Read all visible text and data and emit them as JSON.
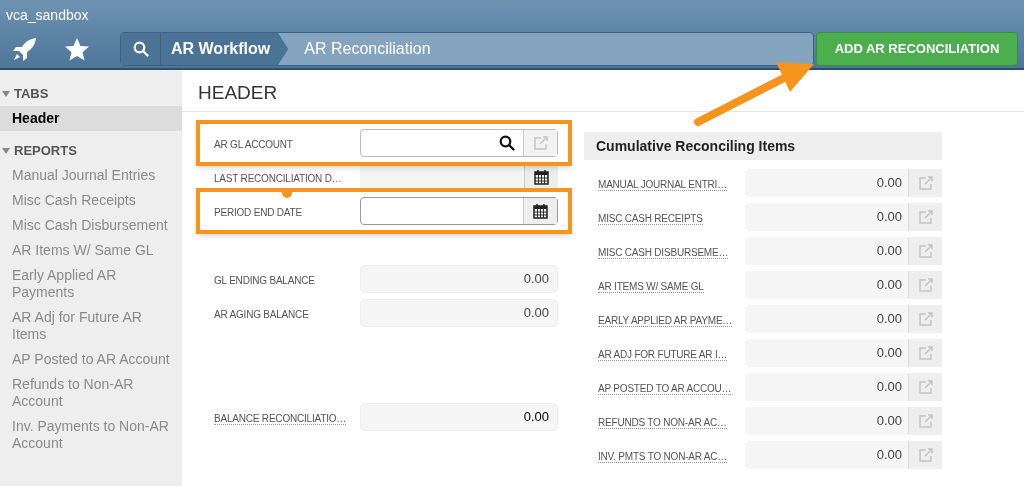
{
  "window": {
    "title": "vca_sandbox"
  },
  "breadcrumbs": [
    {
      "label": "AR Workflow",
      "selected": false
    },
    {
      "label": "AR Reconciliation",
      "selected": true
    }
  ],
  "primary_button": "ADD AR RECONCILIATION",
  "sidebar": {
    "sections": [
      {
        "title": "TABS",
        "expanded": true,
        "items": [
          {
            "label": "Header",
            "selected": true
          }
        ]
      },
      {
        "title": "REPORTS",
        "expanded": true,
        "items": [
          {
            "label": "Manual Journal Entries",
            "selected": false
          },
          {
            "label": "Misc Cash Receipts",
            "selected": false
          },
          {
            "label": "Misc Cash Disbursement",
            "selected": false
          },
          {
            "label": "AR Items W/ Same GL",
            "selected": false
          },
          {
            "label": "Early Applied AR Payments",
            "selected": false
          },
          {
            "label": "AR Adj for Future AR Items",
            "selected": false
          },
          {
            "label": "AP Posted to AR Account",
            "selected": false
          },
          {
            "label": "Refunds to Non-AR Account",
            "selected": false
          },
          {
            "label": "Inv. Payments to Non-AR Account",
            "selected": false
          }
        ]
      }
    ]
  },
  "section_title": "HEADER",
  "fields": [
    {
      "label": "AR GL ACCOUNT",
      "kind": "lookup",
      "highlighted": true
    },
    {
      "label": "LAST RECONCILIATION D…",
      "kind": "date",
      "disabled": true,
      "highlighted": false
    },
    {
      "label": "PERIOD END DATE",
      "kind": "date",
      "disabled": false,
      "highlighted": true
    },
    {
      "label": "GL ENDING BALANCE",
      "kind": "number",
      "value": "0.00",
      "highlighted": false
    },
    {
      "label": "AR AGING BALANCE",
      "kind": "number",
      "value": "0.00",
      "highlighted": false
    },
    {
      "label": "BALANCE RECONCILIATIO…",
      "kind": "total",
      "value": "0.00",
      "highlighted": false
    }
  ],
  "panel": {
    "title": "Cumulative Reconciling Items",
    "rows": [
      {
        "label": "MANUAL JOURNAL ENTRI…",
        "value": "0.00"
      },
      {
        "label": "MISC CASH RECEIPTS",
        "value": "0.00"
      },
      {
        "label": "MISC CASH DISBURSEME…",
        "value": "0.00"
      },
      {
        "label": "AR ITEMS W/ SAME GL",
        "value": "0.00"
      },
      {
        "label": "EARLY APPLIED AR PAYME…",
        "value": "0.00"
      },
      {
        "label": "AR ADJ FOR FUTURE AR I…",
        "value": "0.00"
      },
      {
        "label": "AP POSTED TO AR ACCOU…",
        "value": "0.00"
      },
      {
        "label": "REFUNDS TO NON-AR AC…",
        "value": "0.00"
      },
      {
        "label": "INV. PMTS TO NON-AR AC…",
        "value": "0.00"
      }
    ]
  }
}
